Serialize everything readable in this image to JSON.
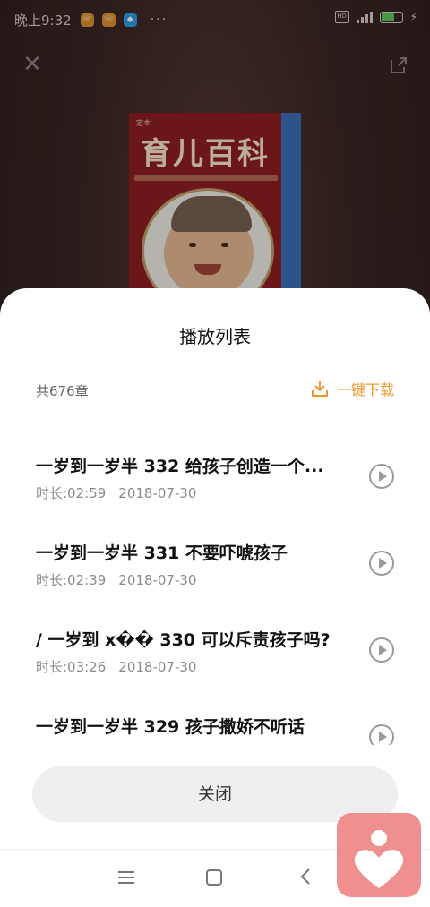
{
  "status_bar": {
    "time": "晚上9:32",
    "more": "···",
    "volte": "HD"
  },
  "cover": {
    "small_text": "定本",
    "title": "育儿百科"
  },
  "sheet": {
    "title": "播放列表",
    "count": "共676章",
    "download_label": "一键下载",
    "close_label": "关闭"
  },
  "items": [
    {
      "title": "一岁到一岁半 332 给孩子创造一个...",
      "duration": "时长:02:59",
      "date": "2018-07-30"
    },
    {
      "title": "一岁到一岁半 331 不要吓唬孩子",
      "duration": "时长:02:39",
      "date": "2018-07-30"
    },
    {
      "title": "/ 一岁到 x�� 330 可以斥责孩子吗?",
      "duration": "时长:03:26",
      "date": "2018-07-30"
    },
    {
      "title": "一岁到一岁半 329 孩子撒娇不听话",
      "duration": "",
      "date": ""
    }
  ],
  "colors": {
    "accent": "#f0982f",
    "float_app": "#ef8f8f"
  },
  "icons": {
    "close": "close-icon",
    "share": "share-icon",
    "download": "download-icon",
    "play": "play-circle-icon"
  }
}
